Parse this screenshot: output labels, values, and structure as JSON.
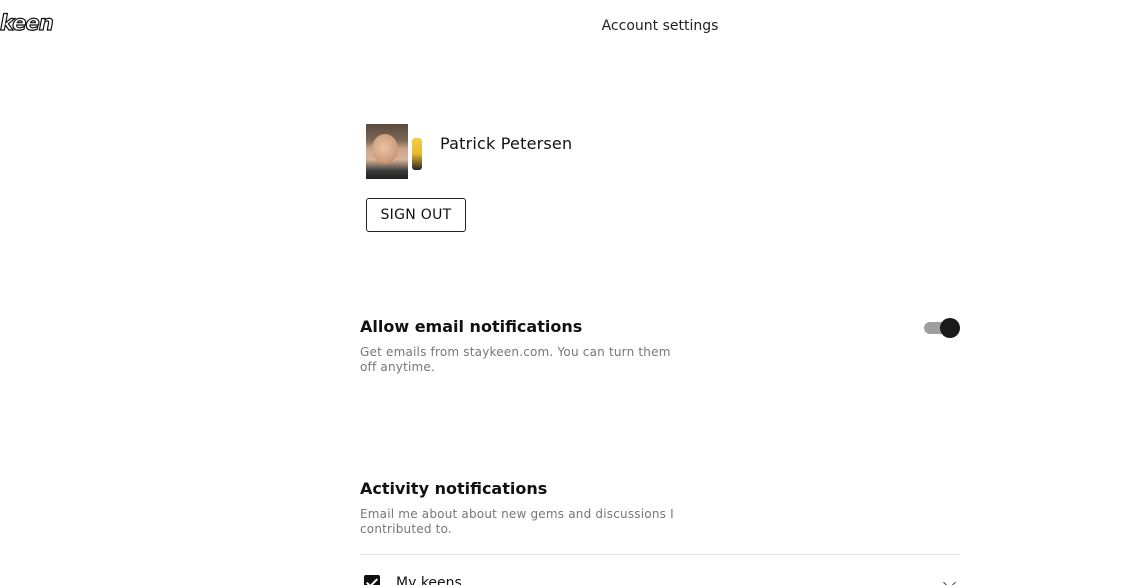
{
  "app": {
    "logo_text": "keen"
  },
  "header": {
    "title": "Account settings"
  },
  "profile": {
    "name": "Patrick Petersen",
    "sign_out_label": "SIGN OUT"
  },
  "email_notifications": {
    "title": "Allow email notifications",
    "description": "Get emails from staykeen.com. You can turn them off anytime.",
    "enabled": true
  },
  "activity_notifications": {
    "title": "Activity notifications",
    "description": "Email me about about new gems and discussions I contributed to.",
    "items": [
      {
        "label": "My keens",
        "checked": true
      }
    ]
  }
}
